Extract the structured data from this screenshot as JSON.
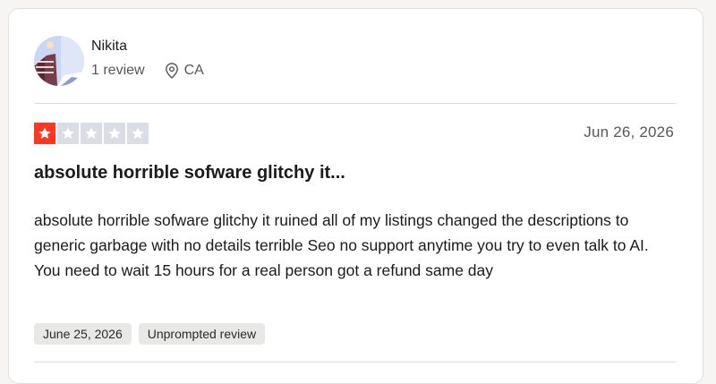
{
  "reviewer": {
    "name": "Nikita",
    "review_count": "1 review",
    "location": "CA"
  },
  "rating": {
    "stars_filled": 1,
    "stars_total": 5,
    "filled_color": "#ff3722",
    "empty_color": "#dcdce6"
  },
  "review": {
    "date": "Jun 26, 2026",
    "title": "absolute horrible sofware glitchy it...",
    "body": "absolute horrible sofware glitchy it ruined all of my listings changed the descriptions to generic garbage with no details terrible Seo no support anytime you try to even talk to AI. You need to wait 15 hours for a real person got a refund same day"
  },
  "tags": {
    "experience_date": "June 25, 2026",
    "type": "Unprompted review"
  },
  "icons": {
    "location": "map-pin-icon",
    "star": "star-icon"
  }
}
